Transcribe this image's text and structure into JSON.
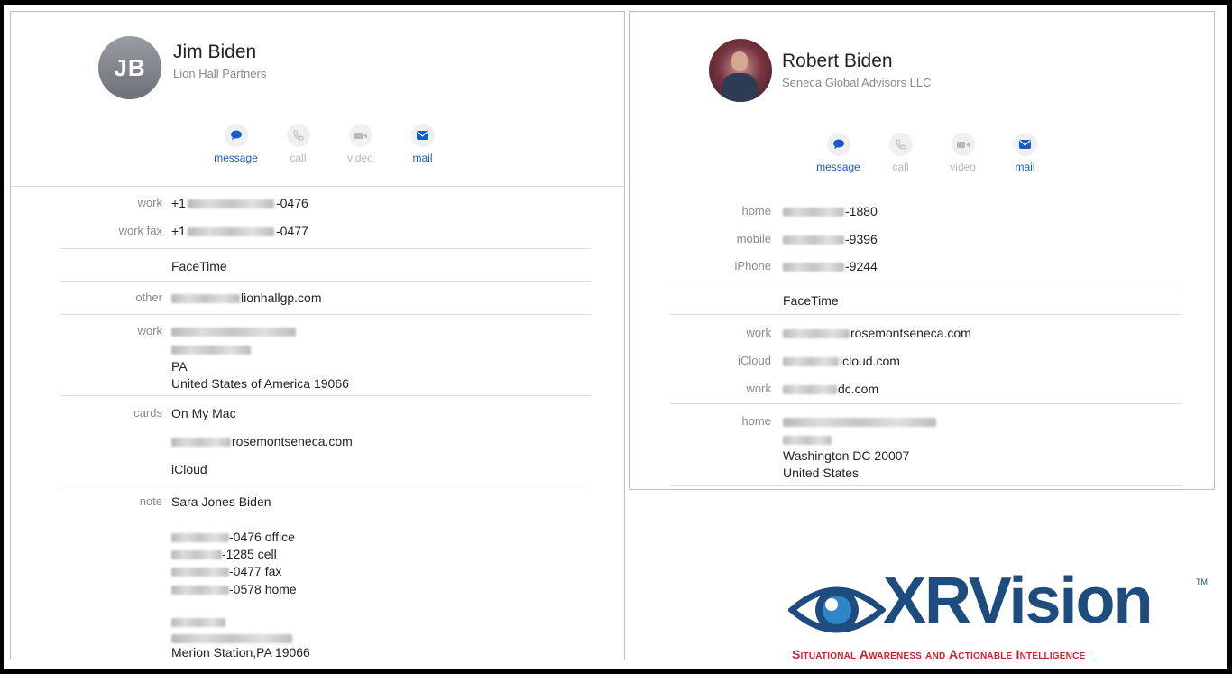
{
  "card1": {
    "initials": "JB",
    "name": "Jim Biden",
    "company": "Lion Hall Partners",
    "actions": [
      {
        "label": "message",
        "icon": "message-icon",
        "enabled": true
      },
      {
        "label": "call",
        "icon": "phone-icon",
        "enabled": false
      },
      {
        "label": "video",
        "icon": "video-icon",
        "enabled": false
      },
      {
        "label": "mail",
        "icon": "mail-icon",
        "enabled": true
      }
    ],
    "work_label": "work",
    "work_prefix": "+1",
    "work_suffix": "-0476",
    "workfax_label": "work fax",
    "workfax_prefix": "+1",
    "workfax_suffix": "-0477",
    "facetime": "FaceTime",
    "other_label": "other",
    "other_suffix": "lionhallgp.com",
    "address_label": "work",
    "address_state": "PA",
    "address_country": "United States of America 19066",
    "cards_label": "cards",
    "cards_value": "On My Mac",
    "cards_email_suffix": "rosemontseneca.com",
    "cards_icloud": "iCloud",
    "note_label": "note",
    "note_title": "Sara Jones Biden",
    "note_lines": [
      "-0476 office",
      "-1285 cell",
      "-0477 fax",
      "-0578 home"
    ],
    "note_address": "Merion Station,PA  19066"
  },
  "card2": {
    "name": "Robert Biden",
    "company": "Seneca Global Advisors LLC",
    "actions": [
      {
        "label": "message",
        "icon": "message-icon",
        "enabled": true
      },
      {
        "label": "call",
        "icon": "phone-icon",
        "enabled": false
      },
      {
        "label": "video",
        "icon": "video-icon",
        "enabled": false
      },
      {
        "label": "mail",
        "icon": "mail-icon",
        "enabled": true
      }
    ],
    "home_label": "home",
    "home_suffix": "-1880",
    "mobile_label": "mobile",
    "mobile_suffix": "-9396",
    "iphone_label": "iPhone",
    "iphone_suffix": "-9244",
    "facetime": "FaceTime",
    "work_email_label": "work",
    "work_email_suffix": "rosemontseneca.com",
    "icloud_label": "iCloud",
    "icloud_suffix": "icloud.com",
    "work2_label": "work",
    "work2_suffix": "dc.com",
    "address_label": "home",
    "address_city": "Washington DC 20007",
    "address_country": "United States"
  },
  "logo": {
    "brand": "XR",
    "brand_rest": "Vision",
    "tm": "TM",
    "tagline": "Situational Awareness and Actionable Intelligence"
  }
}
